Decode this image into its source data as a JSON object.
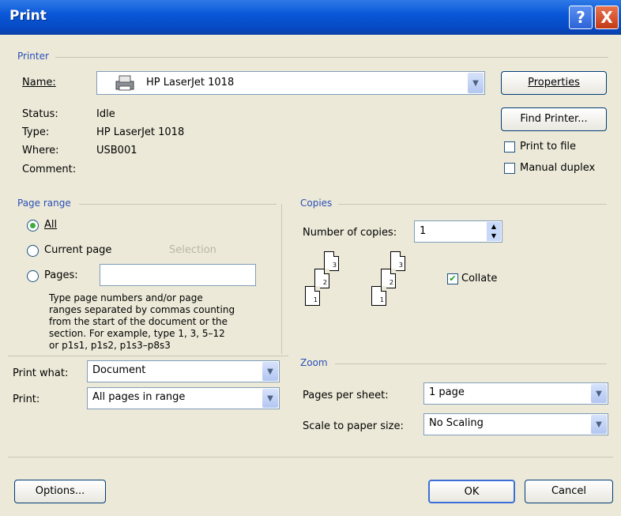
{
  "window": {
    "title": "Print",
    "help_glyph": "?",
    "close_glyph": "X"
  },
  "printer": {
    "group_label": "Printer",
    "name_label": "Name:",
    "name_value": "HP LaserJet 1018",
    "status_label": "Status:",
    "status_value": "Idle",
    "type_label": "Type:",
    "type_value": "HP LaserJet 1018",
    "where_label": "Where:",
    "where_value": "USB001",
    "comment_label": "Comment:",
    "comment_value": "",
    "properties_button": "Properties",
    "find_printer_button": "Find Printer...",
    "print_to_file_label": "Print to file",
    "print_to_file_checked": false,
    "manual_duplex_label": "Manual duplex",
    "manual_duplex_checked": false
  },
  "page_range": {
    "group_label": "Page range",
    "all_label": "All",
    "current_page_label": "Current page",
    "selection_label": "Selection",
    "pages_label": "Pages:",
    "pages_value": "",
    "selected": "all",
    "help_lines": [
      "Type page numbers and/or page",
      "ranges separated by commas counting",
      "from the start of the document or the",
      "section. For example, type 1, 3, 5–12",
      "or p1s1, p1s2, p1s3–p8s3"
    ]
  },
  "copies": {
    "group_label": "Copies",
    "number_label": "Number of copies:",
    "number_value": "1",
    "collate_label": "Collate",
    "collate_checked": true,
    "stack_numbers": [
      "3",
      "2",
      "1"
    ]
  },
  "print_what": {
    "label": "Print what:",
    "value": "Document"
  },
  "print": {
    "label": "Print:",
    "value": "All pages in range"
  },
  "zoom": {
    "group_label": "Zoom",
    "pages_per_sheet_label": "Pages per sheet:",
    "pages_per_sheet_value": "1 page",
    "scale_label": "Scale to paper size:",
    "scale_value": "No Scaling"
  },
  "footer": {
    "options_button": "Options...",
    "ok_button": "OK",
    "cancel_button": "Cancel"
  },
  "colors": {
    "title_bar": "#0a58d8",
    "group_label": "#2a4fb8",
    "dialog_bg": "#ece9d8"
  },
  "icons": {
    "printer": "printer-icon",
    "dropdown": "chevron-down-icon",
    "spinner": "spinner-icon"
  }
}
